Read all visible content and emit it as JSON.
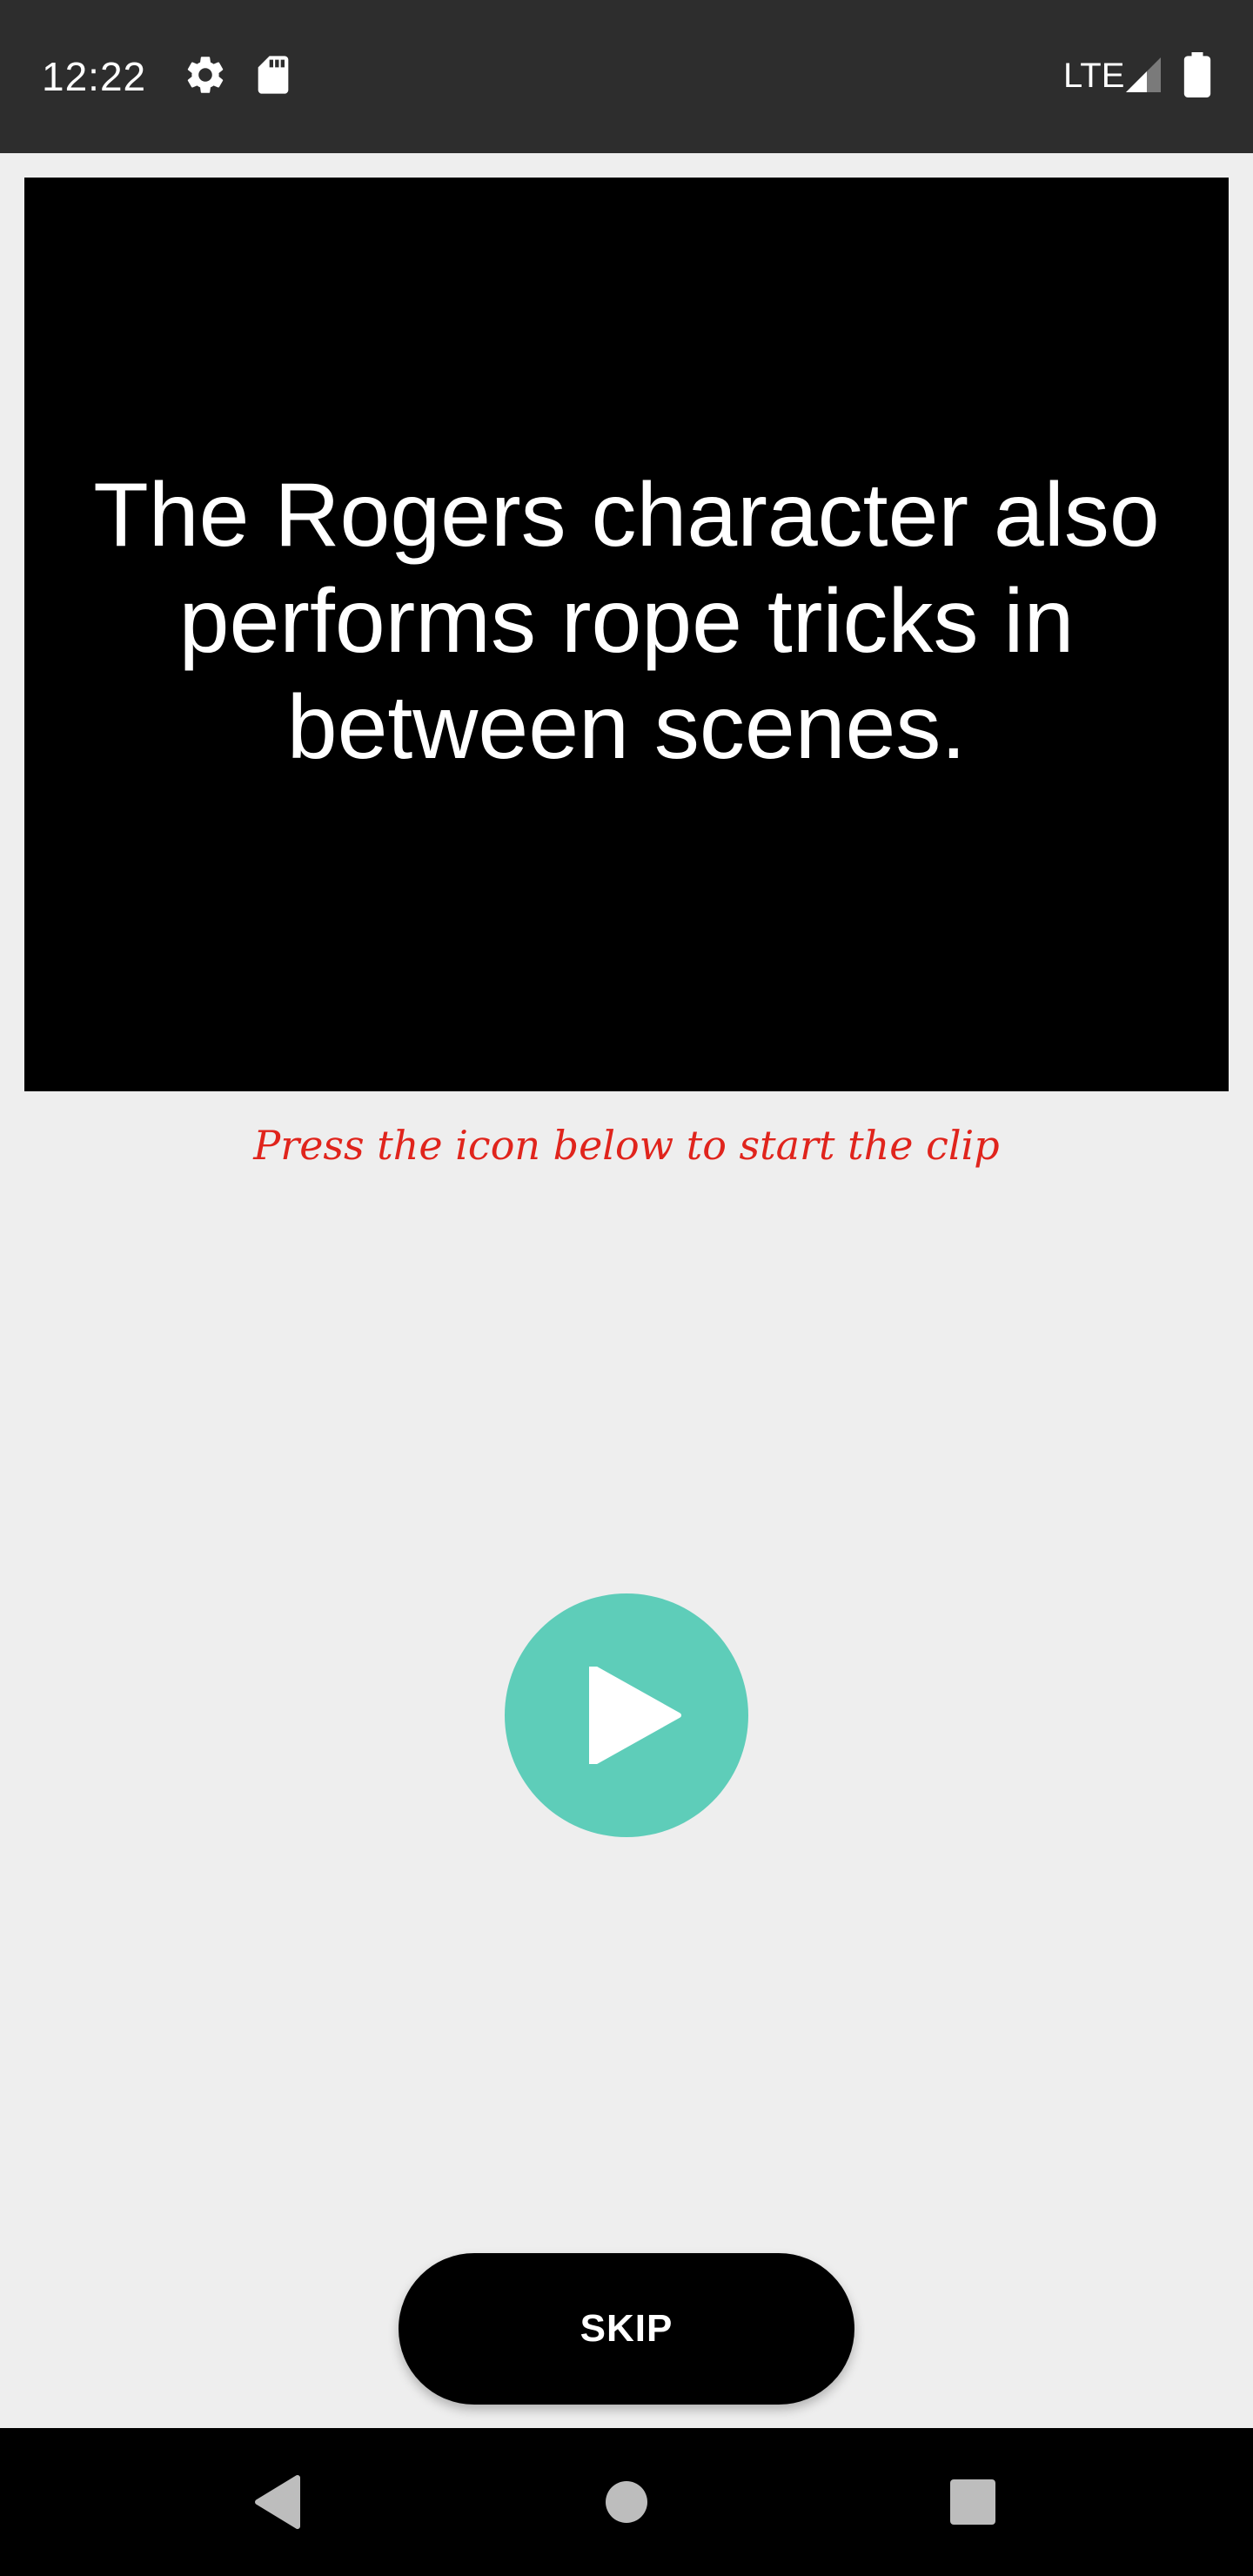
{
  "status_bar": {
    "time": "12:22",
    "network": "LTE",
    "icons": [
      "settings-icon",
      "sd-card-icon",
      "signal-icon",
      "battery-icon"
    ]
  },
  "clip": {
    "text": "The Rogers character also performs rope tricks in between scenes."
  },
  "hint": {
    "text": "Press the icon below to start the clip"
  },
  "play_button": {
    "icon": "play-icon",
    "color": "#5ecdb9"
  },
  "skip_button": {
    "label": "SKIP"
  },
  "nav_bar": {
    "icons": [
      "back-icon",
      "home-icon",
      "recents-icon"
    ]
  },
  "colors": {
    "background": "#eeeeee",
    "status_bar": "#2d2d2d",
    "hint": "#e0241c",
    "accent": "#5ecdb9"
  }
}
